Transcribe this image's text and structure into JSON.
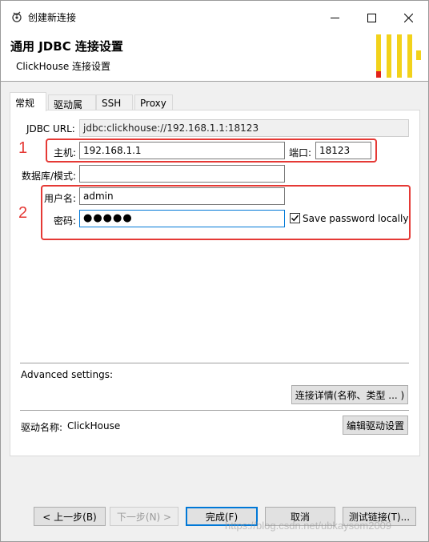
{
  "window": {
    "title": "创建新连接",
    "header_title": "通用 JDBC 连接设置",
    "header_subtitle": "ClickHouse 连接设置"
  },
  "tabs": [
    {
      "label": "常规",
      "active": true
    },
    {
      "label": "驱动属性",
      "active": false
    },
    {
      "label": "SSH",
      "active": false
    },
    {
      "label": "Proxy",
      "active": false
    }
  ],
  "form": {
    "jdbc_url_label": "JDBC URL:",
    "jdbc_url_value": "jdbc:clickhouse://192.168.1.1:18123",
    "host_label": "主机:",
    "host_value": "192.168.1.1",
    "port_label": "端口:",
    "port_value": "18123",
    "database_label": "数据库/模式:",
    "database_value": "",
    "user_label": "用户名:",
    "user_value": "admin",
    "password_label": "密码:",
    "password_value": "●●●●●",
    "save_password_label": "Save password locally",
    "save_password_checked": true
  },
  "annotations": {
    "box1_number": "1",
    "box2_number": "2",
    "color": "#e53935"
  },
  "advanced": {
    "label": "Advanced settings:",
    "details_button": "连接详情(名称、类型 ... )"
  },
  "driver": {
    "label": "驱动名称:",
    "value": "ClickHouse",
    "edit_button": "编辑驱动设置"
  },
  "footer": {
    "back_button": "< 上一步(B)",
    "next_button": "下一步(N) >",
    "finish_button": "完成(F)",
    "cancel_button": "取消",
    "test_button": "测试链接(T)..."
  },
  "watermark": "https://blog.csdn.net/ubkaysom2009",
  "colors": {
    "accent_blue": "#0078d7",
    "logo_yellow": "#f2d21b",
    "logo_red": "#e2231a"
  }
}
